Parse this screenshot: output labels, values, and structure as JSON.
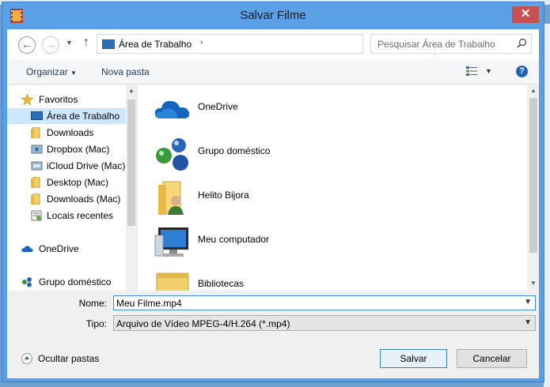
{
  "window": {
    "title": "Salvar Filme"
  },
  "address": {
    "location": "Área de Trabalho",
    "search_placeholder": "Pesquisar Área de Trabalho"
  },
  "toolbar": {
    "organize": "Organizar",
    "new_folder": "Nova pasta"
  },
  "navpane": {
    "favorites_header": "Favoritos",
    "favorites": [
      "Área de Trabalho",
      "Downloads",
      "Dropbox (Mac)",
      "iCloud Drive (Mac)",
      "Desktop (Mac)",
      "Downloads (Mac)",
      "Locais recentes"
    ],
    "onedrive": "OneDrive",
    "homegroup": "Grupo doméstico"
  },
  "content": {
    "items": [
      {
        "label": "OneDrive",
        "icon": "cloud-icon"
      },
      {
        "label": "Grupo doméstico",
        "icon": "homegroup-icon"
      },
      {
        "label": "Helito Bijora",
        "icon": "user-folder-icon"
      },
      {
        "label": "Meu computador",
        "icon": "computer-icon"
      },
      {
        "label": "Bibliotecas",
        "icon": "libraries-icon"
      }
    ]
  },
  "form": {
    "name_label": "Nome:",
    "name_value": "Meu Filme.mp4",
    "type_label": "Tipo:",
    "type_value": "Arquivo de Vídeo MPEG-4/H.264 (*.mp4)"
  },
  "footer": {
    "hide_folders": "Ocultar pastas",
    "save": "Salvar",
    "cancel": "Cancelar"
  },
  "colors": {
    "titlebar": "#5aa0e6",
    "close": "#c75050",
    "selection": "#cce8ff",
    "link": "#1e395b"
  }
}
